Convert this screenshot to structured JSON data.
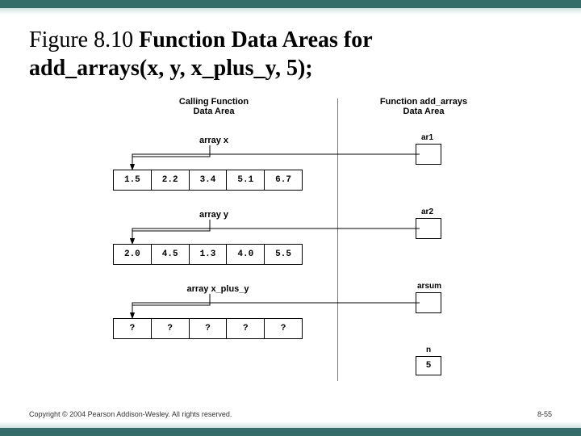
{
  "title": {
    "prefix": "Figure 8.10  ",
    "main": "Function Data Areas for",
    "call": "add_arrays(x, y, x_plus_y, 5);"
  },
  "columns": {
    "left": "Calling Function\nData Area",
    "right": "Function add_arrays\nData Area"
  },
  "arrays": {
    "x": {
      "label": "array x",
      "cells": [
        "1.5",
        "2.2",
        "3.4",
        "5.1",
        "6.7"
      ]
    },
    "y": {
      "label": "array y",
      "cells": [
        "2.0",
        "4.5",
        "1.3",
        "4.0",
        "5.5"
      ]
    },
    "xp": {
      "label": "array x_plus_y",
      "cells": [
        "?",
        "?",
        "?",
        "?",
        "?"
      ]
    }
  },
  "params": {
    "ar1": "ar1",
    "ar2": "ar2",
    "arsum": "arsum",
    "n_label": "n",
    "n_value": "5"
  },
  "footer": {
    "copyright": "Copyright © 2004 Pearson Addison-Wesley. All rights reserved.",
    "page": "8-55"
  }
}
